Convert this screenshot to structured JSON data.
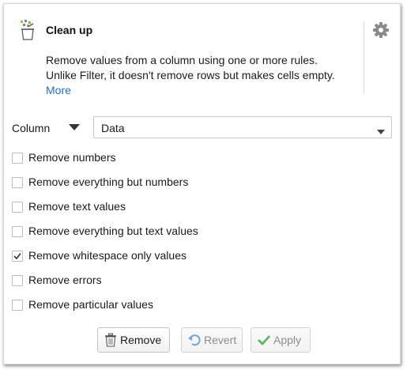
{
  "header": {
    "title": "Clean up",
    "description_line1": "Remove values from a column using one or more rules.",
    "description_line2": "Unlike Filter, it doesn't remove rows but makes cells empty.",
    "more_link": "More"
  },
  "column": {
    "label": "Column",
    "selected": "Data"
  },
  "options": [
    {
      "label": "Remove numbers",
      "checked": false
    },
    {
      "label": "Remove everything but numbers",
      "checked": false
    },
    {
      "label": "Remove text values",
      "checked": false
    },
    {
      "label": "Remove everything but text values",
      "checked": false
    },
    {
      "label": "Remove whitespace only values",
      "checked": true
    },
    {
      "label": "Remove errors",
      "checked": false
    },
    {
      "label": "Remove particular values",
      "checked": false
    }
  ],
  "buttons": {
    "remove": "Remove",
    "revert": "Revert",
    "apply": "Apply"
  },
  "colors": {
    "link": "#1f6fd1",
    "apply_check": "#5cb85c",
    "revert_icon": "#6ea7dd"
  }
}
